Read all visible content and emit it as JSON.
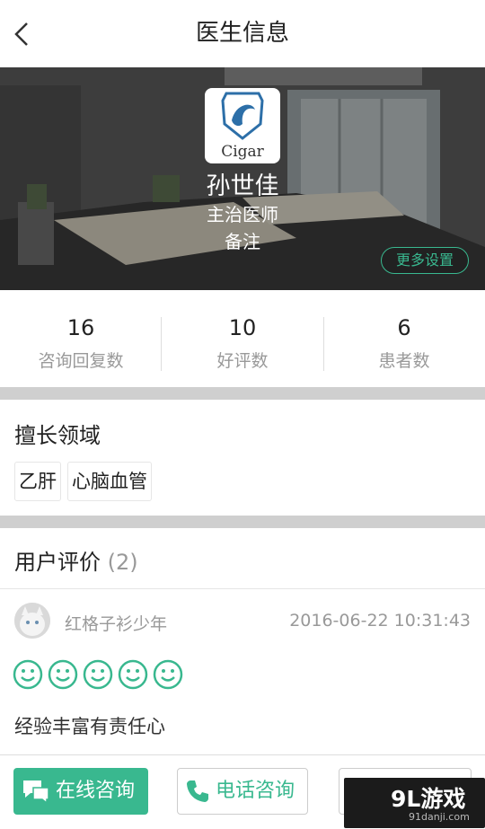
{
  "header": {
    "title": "医生信息"
  },
  "profile": {
    "logo_text": "Cigar",
    "name": "孙世佳",
    "title": "主治医师",
    "note": "备注",
    "more_settings": "更多设置"
  },
  "stats": [
    {
      "value": "16",
      "label": "咨询回复数"
    },
    {
      "value": "10",
      "label": "好评数"
    },
    {
      "value": "6",
      "label": "患者数"
    }
  ],
  "expertise": {
    "heading": "擅长领域",
    "tags": [
      "乙肝",
      "心脑血管"
    ]
  },
  "reviews": {
    "heading": "用户评价",
    "count": "(2)",
    "items": [
      {
        "user": "红格子衫少年",
        "time": "2016-06-22 10:31:43",
        "rating": 5,
        "text": "经验丰富有责任心"
      }
    ]
  },
  "bottom": {
    "online": "在线咨询",
    "phone": "电话咨询"
  },
  "watermark": {
    "main": "9L游戏",
    "sub": "91danji.com"
  },
  "colors": {
    "accent": "#39b88f"
  }
}
